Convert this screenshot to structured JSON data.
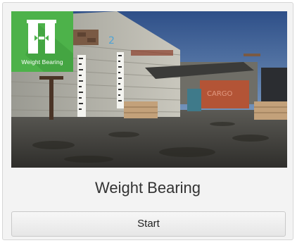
{
  "module": {
    "badge_label": "Weight Bearing",
    "badge_icon": "weight-bearing-icon",
    "title": "Weight Bearing",
    "start_label": "Start",
    "scene_sign_number": "2",
    "scene_container_text": "CARGO"
  },
  "colors": {
    "badge_green": "#4db24a",
    "card_background": "#f3f3f3",
    "title_text": "#333333"
  }
}
